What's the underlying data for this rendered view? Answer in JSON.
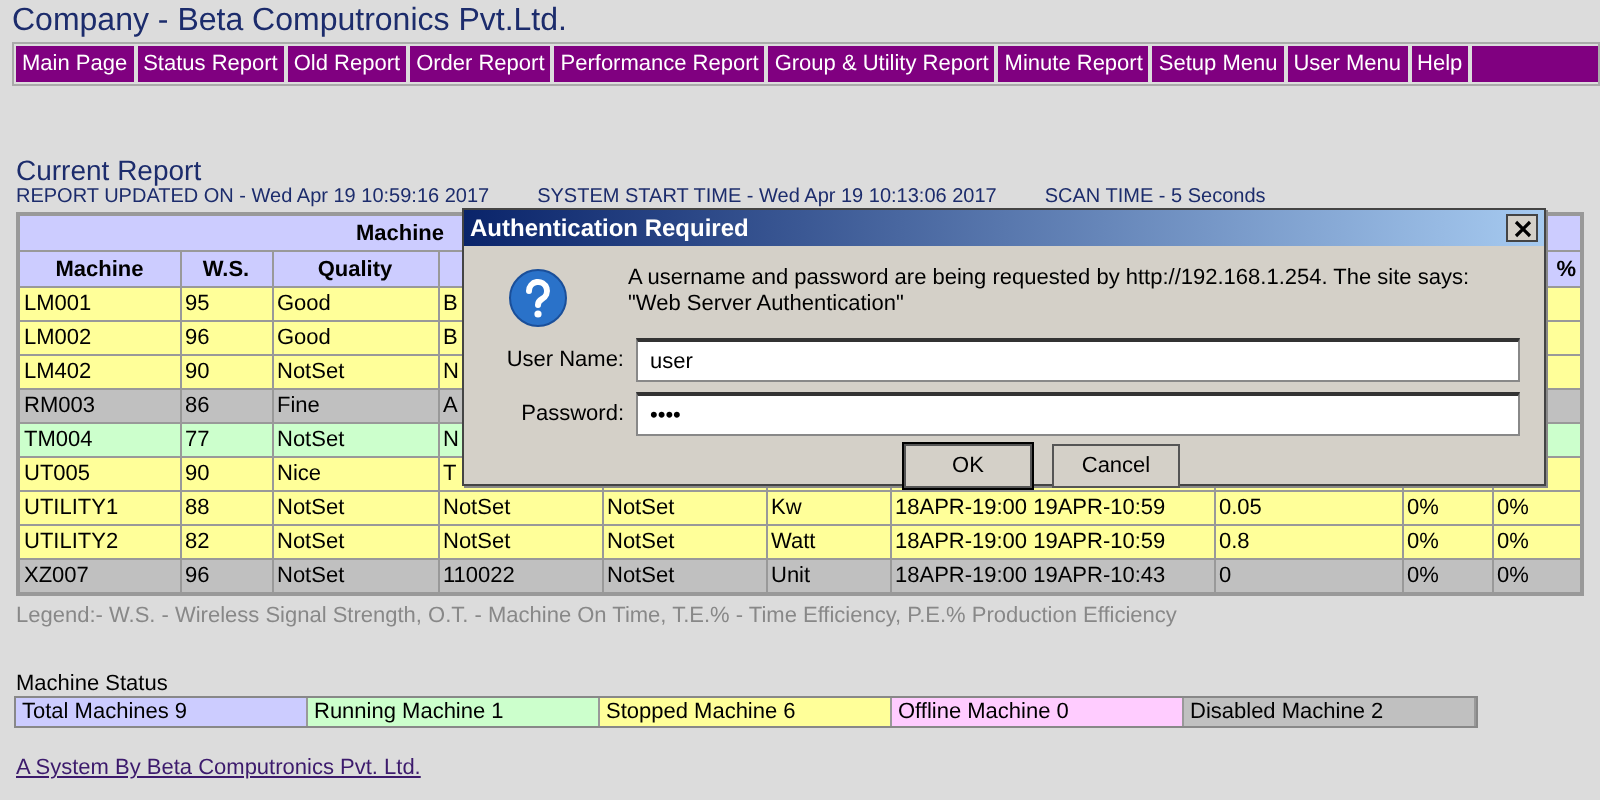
{
  "page": {
    "title": "Company - Beta Computronics Pvt.Ltd."
  },
  "nav": [
    "Main Page",
    "Status Report",
    "Old Report",
    "Order Report",
    "Performance Report",
    "Group & Utility Report",
    "Minute Report",
    "Setup Menu",
    "User Menu",
    "Help"
  ],
  "report": {
    "heading": "Current Report",
    "updated": "REPORT UPDATED ON - Wed Apr 19 10:59:16 2017",
    "start_time": "SYSTEM START TIME - Wed Apr 19 10:13:06 2017",
    "scan_time": "SCAN TIME - 5 Seconds"
  },
  "table": {
    "group_heading": "Machine",
    "columns": [
      "Machine",
      "W.S.",
      "Quality"
    ],
    "column_10": "%",
    "rows": [
      {
        "color": "#ffff99",
        "cells": [
          "LM001",
          "95",
          "Good",
          "B"
        ]
      },
      {
        "color": "#ffff99",
        "cells": [
          "LM002",
          "96",
          "Good",
          "B"
        ]
      },
      {
        "color": "#ffff99",
        "cells": [
          "LM402",
          "90",
          "NotSet",
          "N"
        ]
      },
      {
        "color": "#c0c0c0",
        "cells": [
          "RM003",
          "86",
          "Fine",
          "A"
        ]
      },
      {
        "color": "#ccffcc",
        "cells": [
          "TM004",
          "77",
          "NotSet",
          "N"
        ]
      },
      {
        "color": "#ffff99",
        "cells": [
          "UT005",
          "90",
          "Nice",
          "T"
        ]
      },
      {
        "color": "#ffff99",
        "cells": [
          "UTILITY1",
          "88",
          "NotSet",
          "NotSet",
          "NotSet",
          "Kw",
          "18APR-19:00 19APR-10:59",
          "0.05",
          "0%",
          "0%"
        ]
      },
      {
        "color": "#ffff99",
        "cells": [
          "UTILITY2",
          "82",
          "NotSet",
          "NotSet",
          "NotSet",
          "Watt",
          "18APR-19:00 19APR-10:59",
          "0.8",
          "0%",
          "0%"
        ]
      },
      {
        "color": "#c0c0c0",
        "cells": [
          "XZ007",
          "96",
          "NotSet",
          "110022",
          "NotSet",
          "Unit",
          "18APR-19:00 19APR-10:43",
          "0",
          "0%",
          "0%"
        ]
      }
    ]
  },
  "legend": "Legend:- W.S. - Wireless Signal Strength, O.T. - Machine On Time, T.E.% - Time Efficiency, P.E.% Production Efficiency",
  "machine_status": {
    "heading": "Machine Status",
    "items": [
      {
        "label": "Total Machines 9",
        "color": "#ccccff"
      },
      {
        "label": "Running Machine 1",
        "color": "#ccffcc"
      },
      {
        "label": "Stopped Machine 6",
        "color": "#ffff99"
      },
      {
        "label": "Offline Machine 0",
        "color": "#ffccff"
      },
      {
        "label": "Disabled Machine 2",
        "color": "#c0c0c0"
      }
    ]
  },
  "footer_link": "A System By Beta Computronics Pvt. Ltd.",
  "dialog": {
    "title": "Authentication Required",
    "message": "A username and password are being requested by http://192.168.1.254. The site says: \"Web Server Authentication\"",
    "username_label": "User Name:",
    "username": "user",
    "password_label": "Password:",
    "password": "••••",
    "buttons": [
      "OK",
      "Cancel"
    ]
  }
}
